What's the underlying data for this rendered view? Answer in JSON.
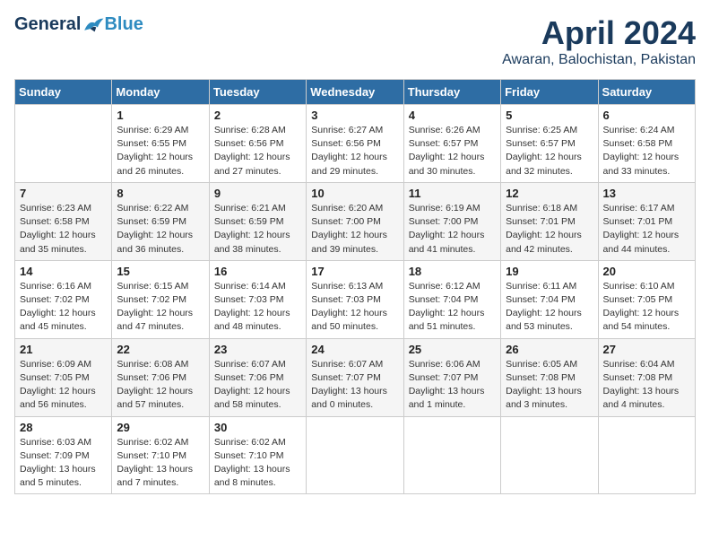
{
  "header": {
    "logo_general": "General",
    "logo_blue": "Blue",
    "month": "April 2024",
    "location": "Awaran, Balochistan, Pakistan"
  },
  "days_of_week": [
    "Sunday",
    "Monday",
    "Tuesday",
    "Wednesday",
    "Thursday",
    "Friday",
    "Saturday"
  ],
  "weeks": [
    [
      {
        "day": "",
        "info": ""
      },
      {
        "day": "1",
        "info": "Sunrise: 6:29 AM\nSunset: 6:55 PM\nDaylight: 12 hours\nand 26 minutes."
      },
      {
        "day": "2",
        "info": "Sunrise: 6:28 AM\nSunset: 6:56 PM\nDaylight: 12 hours\nand 27 minutes."
      },
      {
        "day": "3",
        "info": "Sunrise: 6:27 AM\nSunset: 6:56 PM\nDaylight: 12 hours\nand 29 minutes."
      },
      {
        "day": "4",
        "info": "Sunrise: 6:26 AM\nSunset: 6:57 PM\nDaylight: 12 hours\nand 30 minutes."
      },
      {
        "day": "5",
        "info": "Sunrise: 6:25 AM\nSunset: 6:57 PM\nDaylight: 12 hours\nand 32 minutes."
      },
      {
        "day": "6",
        "info": "Sunrise: 6:24 AM\nSunset: 6:58 PM\nDaylight: 12 hours\nand 33 minutes."
      }
    ],
    [
      {
        "day": "7",
        "info": "Sunrise: 6:23 AM\nSunset: 6:58 PM\nDaylight: 12 hours\nand 35 minutes."
      },
      {
        "day": "8",
        "info": "Sunrise: 6:22 AM\nSunset: 6:59 PM\nDaylight: 12 hours\nand 36 minutes."
      },
      {
        "day": "9",
        "info": "Sunrise: 6:21 AM\nSunset: 6:59 PM\nDaylight: 12 hours\nand 38 minutes."
      },
      {
        "day": "10",
        "info": "Sunrise: 6:20 AM\nSunset: 7:00 PM\nDaylight: 12 hours\nand 39 minutes."
      },
      {
        "day": "11",
        "info": "Sunrise: 6:19 AM\nSunset: 7:00 PM\nDaylight: 12 hours\nand 41 minutes."
      },
      {
        "day": "12",
        "info": "Sunrise: 6:18 AM\nSunset: 7:01 PM\nDaylight: 12 hours\nand 42 minutes."
      },
      {
        "day": "13",
        "info": "Sunrise: 6:17 AM\nSunset: 7:01 PM\nDaylight: 12 hours\nand 44 minutes."
      }
    ],
    [
      {
        "day": "14",
        "info": "Sunrise: 6:16 AM\nSunset: 7:02 PM\nDaylight: 12 hours\nand 45 minutes."
      },
      {
        "day": "15",
        "info": "Sunrise: 6:15 AM\nSunset: 7:02 PM\nDaylight: 12 hours\nand 47 minutes."
      },
      {
        "day": "16",
        "info": "Sunrise: 6:14 AM\nSunset: 7:03 PM\nDaylight: 12 hours\nand 48 minutes."
      },
      {
        "day": "17",
        "info": "Sunrise: 6:13 AM\nSunset: 7:03 PM\nDaylight: 12 hours\nand 50 minutes."
      },
      {
        "day": "18",
        "info": "Sunrise: 6:12 AM\nSunset: 7:04 PM\nDaylight: 12 hours\nand 51 minutes."
      },
      {
        "day": "19",
        "info": "Sunrise: 6:11 AM\nSunset: 7:04 PM\nDaylight: 12 hours\nand 53 minutes."
      },
      {
        "day": "20",
        "info": "Sunrise: 6:10 AM\nSunset: 7:05 PM\nDaylight: 12 hours\nand 54 minutes."
      }
    ],
    [
      {
        "day": "21",
        "info": "Sunrise: 6:09 AM\nSunset: 7:05 PM\nDaylight: 12 hours\nand 56 minutes."
      },
      {
        "day": "22",
        "info": "Sunrise: 6:08 AM\nSunset: 7:06 PM\nDaylight: 12 hours\nand 57 minutes."
      },
      {
        "day": "23",
        "info": "Sunrise: 6:07 AM\nSunset: 7:06 PM\nDaylight: 12 hours\nand 58 minutes."
      },
      {
        "day": "24",
        "info": "Sunrise: 6:07 AM\nSunset: 7:07 PM\nDaylight: 13 hours\nand 0 minutes."
      },
      {
        "day": "25",
        "info": "Sunrise: 6:06 AM\nSunset: 7:07 PM\nDaylight: 13 hours\nand 1 minute."
      },
      {
        "day": "26",
        "info": "Sunrise: 6:05 AM\nSunset: 7:08 PM\nDaylight: 13 hours\nand 3 minutes."
      },
      {
        "day": "27",
        "info": "Sunrise: 6:04 AM\nSunset: 7:08 PM\nDaylight: 13 hours\nand 4 minutes."
      }
    ],
    [
      {
        "day": "28",
        "info": "Sunrise: 6:03 AM\nSunset: 7:09 PM\nDaylight: 13 hours\nand 5 minutes."
      },
      {
        "day": "29",
        "info": "Sunrise: 6:02 AM\nSunset: 7:10 PM\nDaylight: 13 hours\nand 7 minutes."
      },
      {
        "day": "30",
        "info": "Sunrise: 6:02 AM\nSunset: 7:10 PM\nDaylight: 13 hours\nand 8 minutes."
      },
      {
        "day": "",
        "info": ""
      },
      {
        "day": "",
        "info": ""
      },
      {
        "day": "",
        "info": ""
      },
      {
        "day": "",
        "info": ""
      }
    ]
  ]
}
